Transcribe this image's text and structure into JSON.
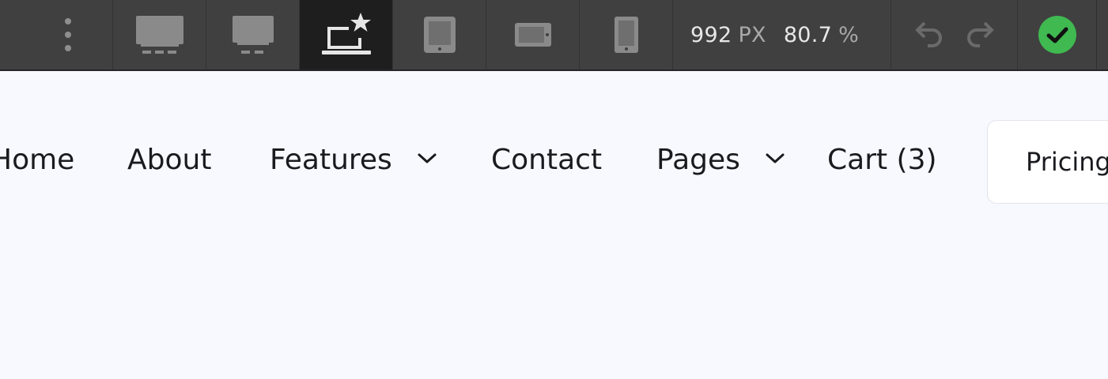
{
  "toolbar": {
    "breakpoints": [
      {
        "icon": "desktop-large-icon",
        "active": false
      },
      {
        "icon": "desktop-icon",
        "active": false
      },
      {
        "icon": "laptop-star-icon",
        "active": true
      },
      {
        "icon": "tablet-icon",
        "active": false
      },
      {
        "icon": "mobile-landscape-icon",
        "active": false
      },
      {
        "icon": "mobile-portrait-icon",
        "active": false
      }
    ],
    "width_value": "992",
    "width_unit": "PX",
    "zoom_value": "80.7",
    "zoom_unit": "%",
    "status_color": "#3fb950"
  },
  "nav": {
    "items": [
      {
        "label": "Home",
        "dropdown": false
      },
      {
        "label": "About",
        "dropdown": false
      },
      {
        "label": "Features",
        "dropdown": true
      },
      {
        "label": "Contact",
        "dropdown": false
      },
      {
        "label": "Pages",
        "dropdown": true
      },
      {
        "label": "Cart (3)",
        "dropdown": false
      }
    ],
    "cta_label": "Pricing"
  }
}
